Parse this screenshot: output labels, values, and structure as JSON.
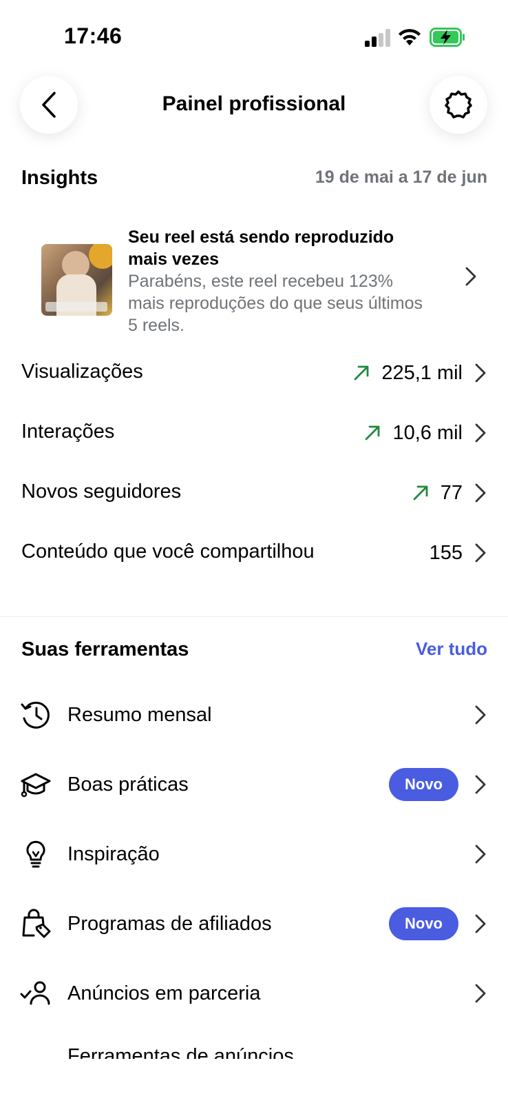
{
  "status_bar": {
    "time": "17:46"
  },
  "header": {
    "title": "Painel profissional"
  },
  "insights": {
    "title": "Insights",
    "date_range": "19 de mai a 17 de jun",
    "reel_card": {
      "title": "Seu reel está sendo reproduzido mais vezes",
      "description": "Parabéns, este reel recebeu 123% mais reproduções do que seus últimos 5 reels."
    },
    "metrics": [
      {
        "label": "Visualizações",
        "value": "225,1 mil",
        "trend": "up"
      },
      {
        "label": "Interações",
        "value": "10,6 mil",
        "trend": "up"
      },
      {
        "label": "Novos seguidores",
        "value": "77",
        "trend": "up"
      },
      {
        "label": "Conteúdo que você compartilhou",
        "value": "155",
        "trend": "none"
      }
    ]
  },
  "tools": {
    "title": "Suas ferramentas",
    "see_all": "Ver tudo",
    "items": [
      {
        "label": "Resumo mensal",
        "icon": "history-icon",
        "badge": ""
      },
      {
        "label": "Boas práticas",
        "icon": "graduation-cap-icon",
        "badge": "Novo"
      },
      {
        "label": "Inspiração",
        "icon": "lightbulb-icon",
        "badge": ""
      },
      {
        "label": "Programas de afiliados",
        "icon": "shopping-bag-tag-icon",
        "badge": "Novo"
      },
      {
        "label": "Anúncios em parceria",
        "icon": "person-check-icon",
        "badge": ""
      },
      {
        "label": "Ferramentas de anúncios",
        "icon": "ads-icon",
        "badge": ""
      }
    ]
  },
  "colors": {
    "accent": "#4a5ce0",
    "trend_up": "#1f8a3b",
    "secondary_text": "#6f7378",
    "battery": "#34c759"
  }
}
